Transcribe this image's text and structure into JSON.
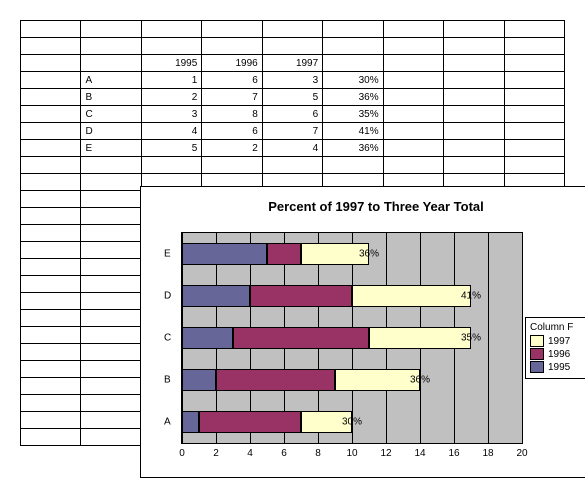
{
  "table": {
    "headers": [
      "1995",
      "1996",
      "1997"
    ],
    "rows": [
      {
        "label": "A",
        "v1": "1",
        "v2": "6",
        "v3": "3",
        "pct": "30%"
      },
      {
        "label": "B",
        "v1": "2",
        "v2": "7",
        "v3": "5",
        "pct": "36%"
      },
      {
        "label": "C",
        "v1": "3",
        "v2": "8",
        "v3": "6",
        "pct": "35%"
      },
      {
        "label": "D",
        "v1": "4",
        "v2": "6",
        "v3": "7",
        "pct": "41%"
      },
      {
        "label": "E",
        "v1": "5",
        "v2": "2",
        "v3": "4",
        "pct": "36%"
      }
    ]
  },
  "chart_data": {
    "type": "bar",
    "orientation": "horizontal",
    "stacked": true,
    "title": "Percent of 1997 to Three Year Total",
    "categories": [
      "A",
      "B",
      "C",
      "D",
      "E"
    ],
    "series": [
      {
        "name": "1995",
        "values": [
          1,
          2,
          3,
          4,
          5
        ],
        "color": "#666699"
      },
      {
        "name": "1996",
        "values": [
          6,
          7,
          8,
          6,
          2
        ],
        "color": "#993366"
      },
      {
        "name": "1997",
        "values": [
          3,
          5,
          6,
          7,
          4
        ],
        "color": "#ffffcc"
      }
    ],
    "data_labels": [
      "30%",
      "36%",
      "35%",
      "41%",
      "36%"
    ],
    "xlim": [
      0,
      20
    ],
    "x_ticks": [
      0,
      2,
      4,
      6,
      8,
      10,
      12,
      14,
      16,
      18,
      20
    ],
    "legend_title": "Column F",
    "legend_order": [
      "1997",
      "1996",
      "1995"
    ]
  }
}
